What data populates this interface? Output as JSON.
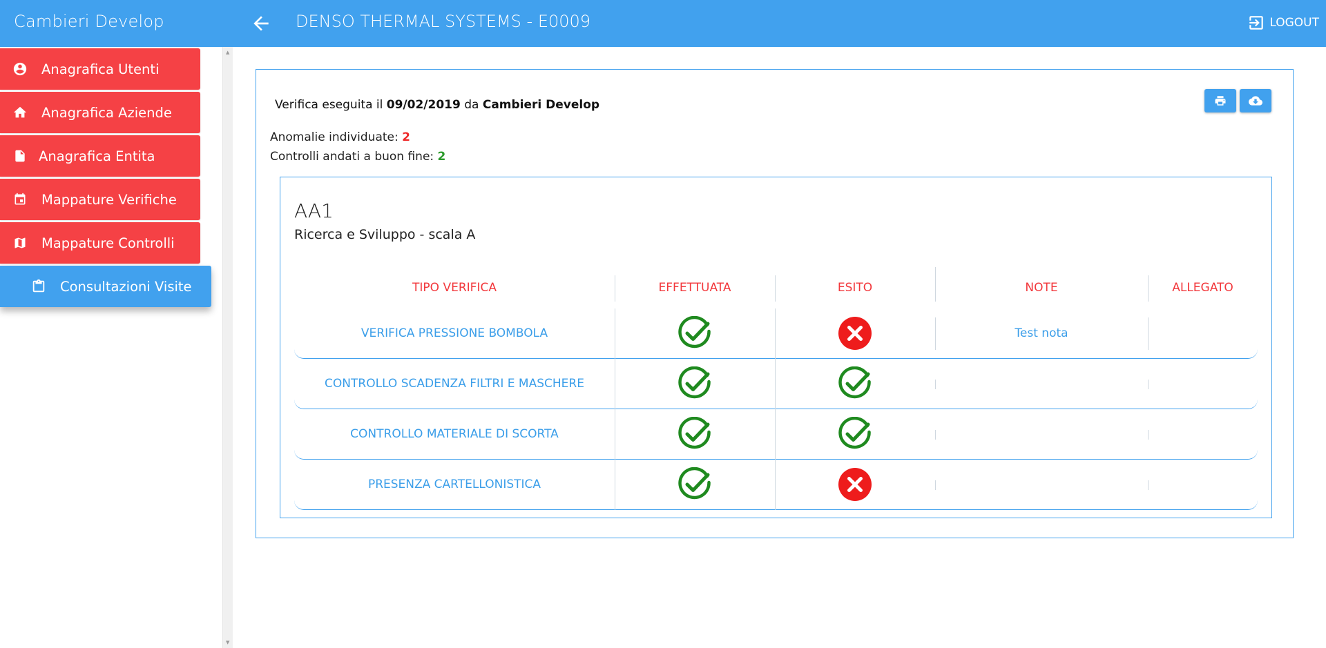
{
  "app": {
    "brand": "Cambieri Develop",
    "title": "DENSO THERMAL SYSTEMS - E0009",
    "logout_label": "LOGOUT"
  },
  "sidebar": {
    "items": [
      {
        "label": "Anagrafica Utenti",
        "icon": "account-circle-icon",
        "active": false
      },
      {
        "label": "Anagrafica Aziende",
        "icon": "home-icon",
        "active": false
      },
      {
        "label": "Anagrafica Entita",
        "icon": "file-icon",
        "active": false
      },
      {
        "label": "Mappature Verifiche",
        "icon": "calendar-icon",
        "active": false
      },
      {
        "label": "Mappature Controlli",
        "icon": "map-icon",
        "active": false
      },
      {
        "label": "Consultazioni Visite",
        "icon": "clipboard-icon",
        "active": true
      }
    ]
  },
  "report": {
    "prefix": "Verifica eseguita il",
    "date": "09/02/2019",
    "by_word": "da",
    "by_name": "Cambieri Develop",
    "anomalies_label": "Anomalie individuate:",
    "anomalies_count": "2",
    "ok_label": "Controlli andati a buon fine:",
    "ok_count": "2",
    "print_icon": "print-icon",
    "download_icon": "cloud-download-icon"
  },
  "entity": {
    "code": "AA1",
    "description": "Ricerca e Sviluppo - scala A"
  },
  "table": {
    "headers": [
      "TIPO VERIFICA",
      "EFFETTUATA",
      "ESITO",
      "NOTE",
      "ALLEGATO"
    ],
    "rows": [
      {
        "tipo": "VERIFICA PRESSIONE BOMBOLA",
        "effettuata": "ok",
        "esito": "ko",
        "note": "Test nota",
        "allegato": ""
      },
      {
        "tipo": "CONTROLLO SCADENZA FILTRI E MASCHERE",
        "effettuata": "ok",
        "esito": "ok",
        "note": "",
        "allegato": ""
      },
      {
        "tipo": "CONTROLLO MATERIALE DI SCORTA",
        "effettuata": "ok",
        "esito": "ok",
        "note": "",
        "allegato": ""
      },
      {
        "tipo": "PRESENZA CARTELLONISTICA",
        "effettuata": "ok",
        "esito": "ko",
        "note": "",
        "allegato": ""
      }
    ]
  },
  "colors": {
    "primary": "#41a1ee",
    "danger": "#f54145",
    "ok": "#1f8a1f",
    "ko": "#ee1c1c"
  }
}
